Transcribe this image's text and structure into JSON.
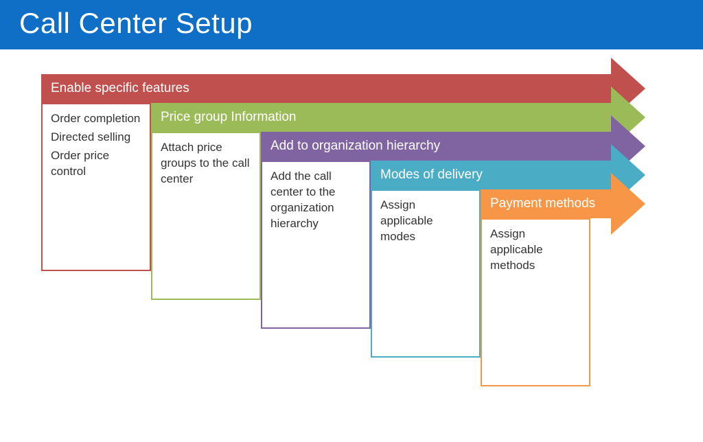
{
  "title": "Call Center Setup",
  "steps": [
    {
      "label": "Enable specific features",
      "color": "#c0504d",
      "items": [
        "Order completion",
        "Directed selling",
        "Order price control"
      ]
    },
    {
      "label": "Price group Information",
      "color": "#9bbb59",
      "items": [
        "Attach price groups to the call center"
      ]
    },
    {
      "label": "Add to organization hierarchy",
      "color": "#8064a2",
      "items": [
        "Add the call center to the organization hierarchy"
      ]
    },
    {
      "label": "Modes of delivery",
      "color": "#4bacc6",
      "items": [
        "Assign applicable modes"
      ]
    },
    {
      "label": "Payment methods",
      "color": "#f79646",
      "items": [
        "Assign applicable methods"
      ]
    }
  ]
}
